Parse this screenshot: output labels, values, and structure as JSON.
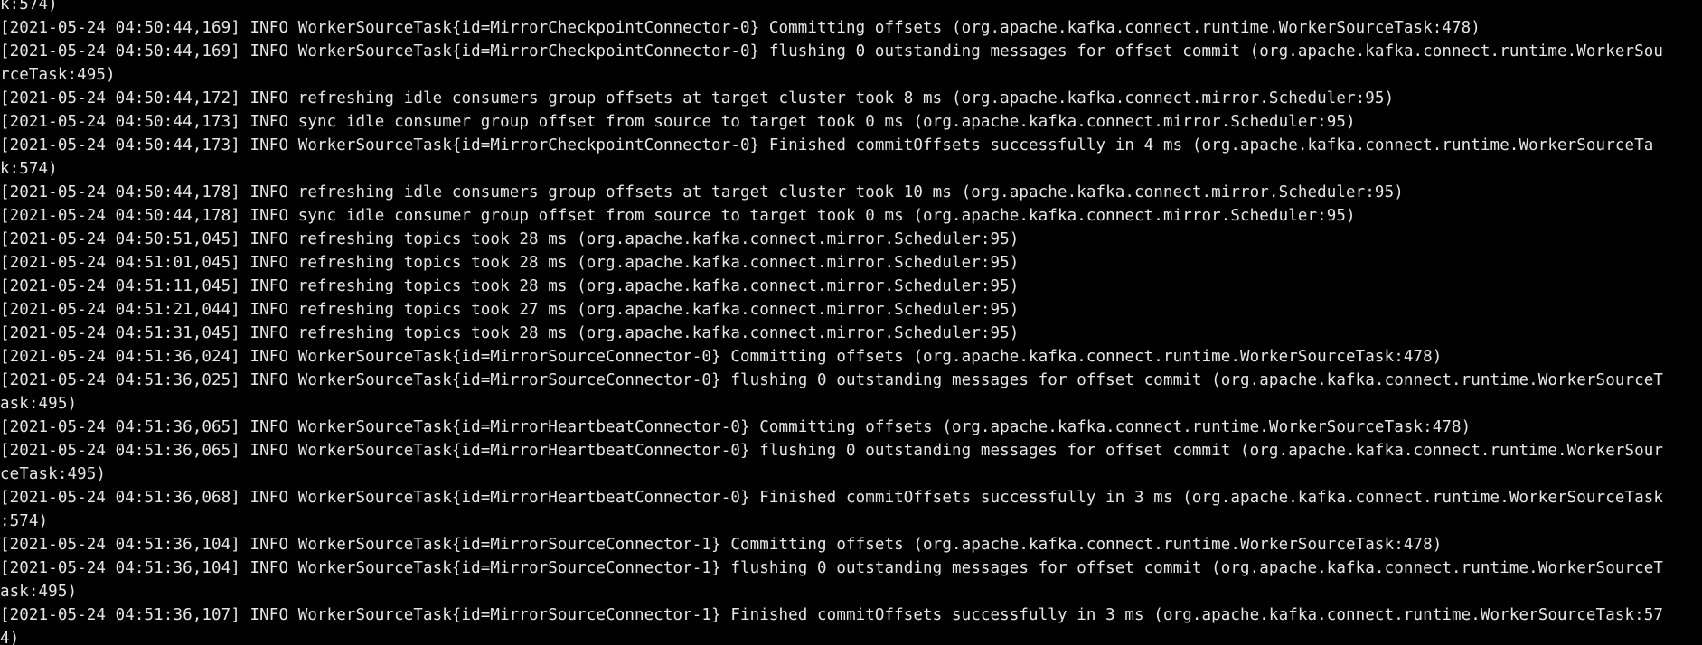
{
  "terminal": {
    "background": "#000000",
    "foreground": "#e6e6e6",
    "lines": [
      "k:574)",
      "[2021-05-24 04:50:44,169] INFO WorkerSourceTask{id=MirrorCheckpointConnector-0} Committing offsets (org.apache.kafka.connect.runtime.WorkerSourceTask:478)",
      "[2021-05-24 04:50:44,169] INFO WorkerSourceTask{id=MirrorCheckpointConnector-0} flushing 0 outstanding messages for offset commit (org.apache.kafka.connect.runtime.WorkerSou",
      "rceTask:495)",
      "[2021-05-24 04:50:44,172] INFO refreshing idle consumers group offsets at target cluster took 8 ms (org.apache.kafka.connect.mirror.Scheduler:95)",
      "[2021-05-24 04:50:44,173] INFO sync idle consumer group offset from source to target took 0 ms (org.apache.kafka.connect.mirror.Scheduler:95)",
      "[2021-05-24 04:50:44,173] INFO WorkerSourceTask{id=MirrorCheckpointConnector-0} Finished commitOffsets successfully in 4 ms (org.apache.kafka.connect.runtime.WorkerSourceTa",
      "k:574)",
      "[2021-05-24 04:50:44,178] INFO refreshing idle consumers group offsets at target cluster took 10 ms (org.apache.kafka.connect.mirror.Scheduler:95)",
      "[2021-05-24 04:50:44,178] INFO sync idle consumer group offset from source to target took 0 ms (org.apache.kafka.connect.mirror.Scheduler:95)",
      "[2021-05-24 04:50:51,045] INFO refreshing topics took 28 ms (org.apache.kafka.connect.mirror.Scheduler:95)",
      "[2021-05-24 04:51:01,045] INFO refreshing topics took 28 ms (org.apache.kafka.connect.mirror.Scheduler:95)",
      "[2021-05-24 04:51:11,045] INFO refreshing topics took 28 ms (org.apache.kafka.connect.mirror.Scheduler:95)",
      "[2021-05-24 04:51:21,044] INFO refreshing topics took 27 ms (org.apache.kafka.connect.mirror.Scheduler:95)",
      "[2021-05-24 04:51:31,045] INFO refreshing topics took 28 ms (org.apache.kafka.connect.mirror.Scheduler:95)",
      "[2021-05-24 04:51:36,024] INFO WorkerSourceTask{id=MirrorSourceConnector-0} Committing offsets (org.apache.kafka.connect.runtime.WorkerSourceTask:478)",
      "[2021-05-24 04:51:36,025] INFO WorkerSourceTask{id=MirrorSourceConnector-0} flushing 0 outstanding messages for offset commit (org.apache.kafka.connect.runtime.WorkerSourceT",
      "ask:495)",
      "[2021-05-24 04:51:36,065] INFO WorkerSourceTask{id=MirrorHeartbeatConnector-0} Committing offsets (org.apache.kafka.connect.runtime.WorkerSourceTask:478)",
      "[2021-05-24 04:51:36,065] INFO WorkerSourceTask{id=MirrorHeartbeatConnector-0} flushing 0 outstanding messages for offset commit (org.apache.kafka.connect.runtime.WorkerSour",
      "ceTask:495)",
      "[2021-05-24 04:51:36,068] INFO WorkerSourceTask{id=MirrorHeartbeatConnector-0} Finished commitOffsets successfully in 3 ms (org.apache.kafka.connect.runtime.WorkerSourceTask",
      ":574)",
      "[2021-05-24 04:51:36,104] INFO WorkerSourceTask{id=MirrorSourceConnector-1} Committing offsets (org.apache.kafka.connect.runtime.WorkerSourceTask:478)",
      "[2021-05-24 04:51:36,104] INFO WorkerSourceTask{id=MirrorSourceConnector-1} flushing 0 outstanding messages for offset commit (org.apache.kafka.connect.runtime.WorkerSourceT",
      "ask:495)",
      "[2021-05-24 04:51:36,107] INFO WorkerSourceTask{id=MirrorSourceConnector-1} Finished commitOffsets successfully in 3 ms (org.apache.kafka.connect.runtime.WorkerSourceTask:57",
      "4)"
    ]
  }
}
